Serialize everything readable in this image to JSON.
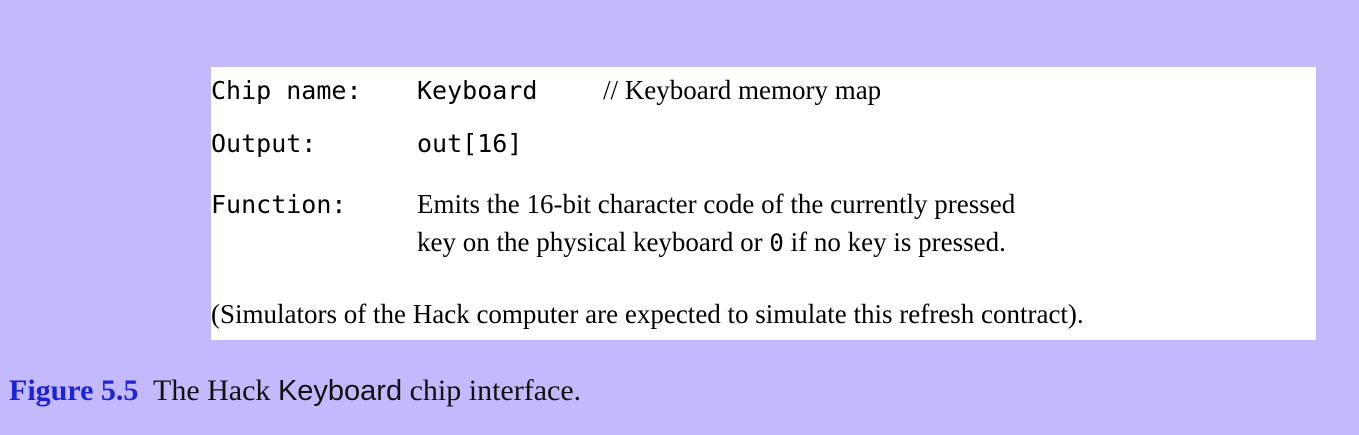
{
  "spec": {
    "chip_label": "Chip name:",
    "chip_value": "Keyboard",
    "chip_comment": "// Keyboard memory map",
    "output_label": "Output:",
    "output_value": "out[16]",
    "function_label": "Function:",
    "function_line1": "Emits the 16-bit character code of the currently pressed",
    "function_line2_pre": "key on the physical keyboard or ",
    "function_line2_code": "0",
    "function_line2_post": " if no key is pressed.",
    "note": "(Simulators of the Hack computer are expected to simulate this refresh contract)."
  },
  "caption": {
    "number": "Figure 5.5",
    "text_pre": "The Hack ",
    "text_code": "Keyboard",
    "text_post": " chip interface."
  },
  "colors": {
    "background": "#c3b9fc",
    "panel": "#ffffff",
    "figure_number": "#1d23d9"
  }
}
